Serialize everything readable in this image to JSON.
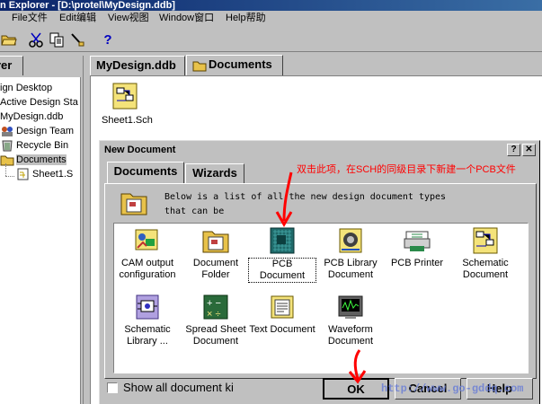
{
  "window": {
    "title": "n Explorer - [D:\\protel\\MyDesign.ddb]"
  },
  "menu": [
    "File文件",
    "Edit编辑",
    "View视图",
    "Window窗口",
    "Help帮助"
  ],
  "explorer": {
    "tab_label": "rer",
    "tree": [
      {
        "label": "ign Desktop",
        "icon": "desktop-icon"
      },
      {
        "label": "Active Design Sta",
        "icon": "design-station-icon"
      },
      {
        "label": "MyDesign.ddb",
        "icon": "database-icon"
      },
      {
        "label": "Design Team",
        "icon": "team-icon"
      },
      {
        "label": "Recycle Bin",
        "icon": "recycle-bin-icon"
      },
      {
        "label": "Documents",
        "icon": "folder-icon"
      },
      {
        "label": "Sheet1.S",
        "icon": "schematic-sheet-icon"
      }
    ]
  },
  "doc_tabs": [
    "MyDesign.ddb",
    "Documents"
  ],
  "workspace": {
    "file_label": "Sheet1.Sch"
  },
  "dialog": {
    "title": "New Document",
    "help_glyph": "?",
    "close_glyph": "✕",
    "tabs": [
      "Documents",
      "Wizards"
    ],
    "description_line1": "Below is a list of all the new design document types",
    "description_line2": "that can be",
    "items": [
      {
        "label": "CAM output configuration",
        "icon": "cam-output-icon"
      },
      {
        "label": "Document Folder",
        "icon": "document-folder-icon"
      },
      {
        "label": "PCB Document",
        "icon": "pcb-document-icon",
        "selected": true
      },
      {
        "label": "PCB Library Document",
        "icon": "pcb-library-icon"
      },
      {
        "label": "PCB Printer",
        "icon": "pcb-printer-icon"
      },
      {
        "label": "Schematic Document",
        "icon": "schematic-document-icon"
      },
      {
        "label": "Schematic Library ...",
        "icon": "schematic-library-icon"
      },
      {
        "label": "Spread Sheet Document",
        "icon": "spreadsheet-icon"
      },
      {
        "label": "Text Document",
        "icon": "text-document-icon"
      },
      {
        "label": "Waveform Document",
        "icon": "waveform-icon"
      }
    ],
    "checkbox_label": "Show all document ki",
    "checkbox_checked": false,
    "ok_label": "OK",
    "cancel_label": "Cancel",
    "help_label": "Help"
  },
  "annotation": "双击此项，在SCH的同级目录下新建一个PCB文件",
  "watermark": "http://www.go-gddq.com",
  "colors": {
    "annotation": "#ff0000",
    "titlebar": "#0a246a",
    "face": "#c0c0c0"
  }
}
